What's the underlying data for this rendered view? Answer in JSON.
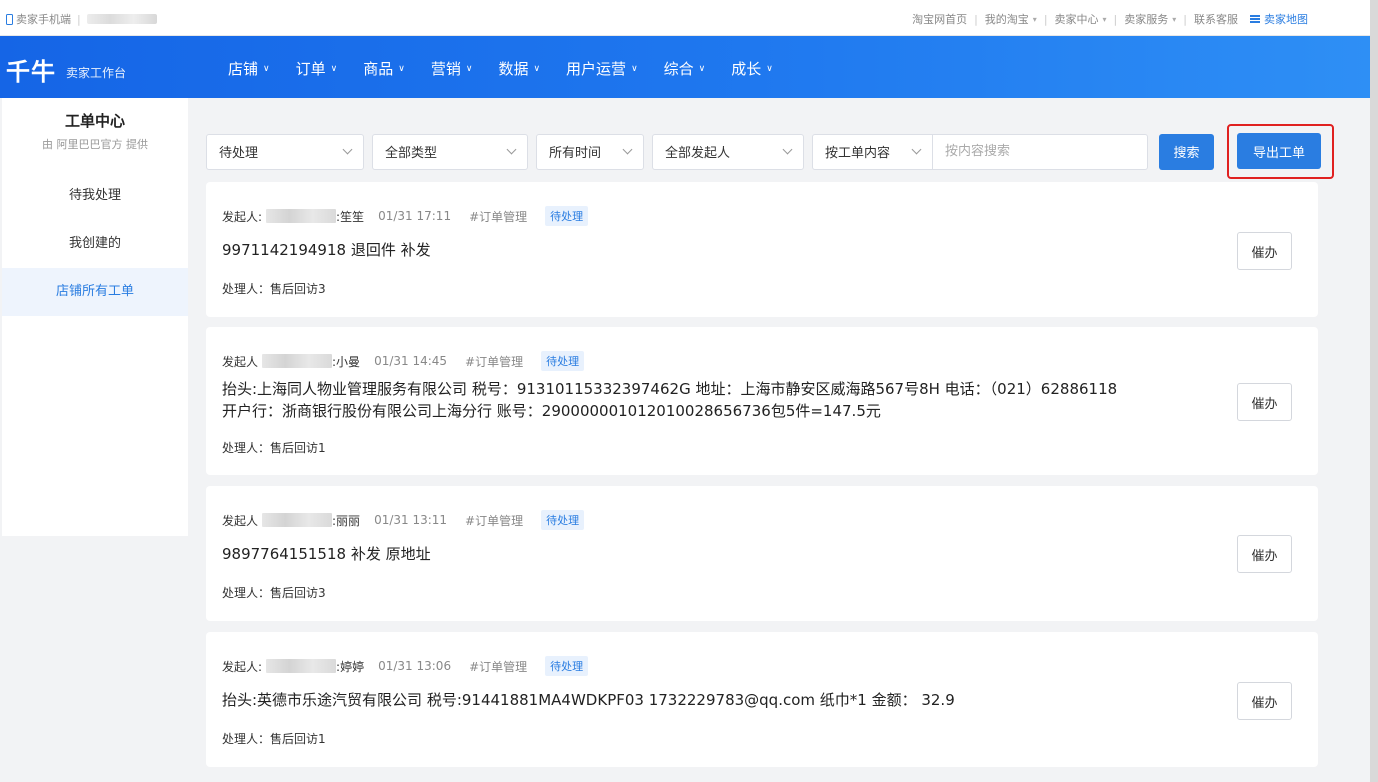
{
  "topbar": {
    "mobile_label": "卖家手机端",
    "links": [
      {
        "label": "淘宝网首页",
        "dropdown": false
      },
      {
        "label": "我的淘宝",
        "dropdown": true
      },
      {
        "label": "卖家中心",
        "dropdown": true
      },
      {
        "label": "卖家服务",
        "dropdown": true
      },
      {
        "label": "联系客服",
        "dropdown": false
      }
    ],
    "map_label": "卖家地图"
  },
  "nav": {
    "logo": "千牛",
    "logo_sub": "卖家工作台",
    "menu": [
      "店铺",
      "订单",
      "商品",
      "营销",
      "数据",
      "用户运营",
      "综合",
      "成长"
    ]
  },
  "sidebar": {
    "title": "工单中心",
    "subtitle": "由 阿里巴巴官方 提供",
    "items": [
      {
        "label": "待我处理",
        "active": false
      },
      {
        "label": "我创建的",
        "active": false
      },
      {
        "label": "店铺所有工单",
        "active": true
      }
    ]
  },
  "filters": {
    "status": "待处理",
    "type": "全部类型",
    "time": "所有时间",
    "initiator": "全部发起人",
    "search_field": "按工单内容",
    "search_placeholder": "按内容搜索",
    "search_button": "搜索",
    "export_button": "导出工单"
  },
  "tickets": [
    {
      "initiator_label": "发起人:",
      "initiator_name": ":笙笙",
      "time": "01/31 17:11",
      "tag": "#订单管理",
      "status": "待处理",
      "content_lines": [
        "9971142194918 退回件 补发"
      ],
      "handler": "处理人：售后回访3",
      "action": "催办"
    },
    {
      "initiator_label": "发起人",
      "initiator_name": ":小曼",
      "time": "01/31 14:45",
      "tag": "#订单管理",
      "status": "待处理",
      "content_lines": [
        "抬头:上海同人物业管理服务有限公司 税号：91310115332397462G 地址：上海市静安区威海路567号8H 电话：（021）62886118",
        "开户行：浙商银行股份有限公司上海分行 账号：290000001012010028656736包5件=147.5元"
      ],
      "handler": "处理人：售后回访1",
      "action": "催办"
    },
    {
      "initiator_label": "发起人",
      "initiator_name": ":丽丽",
      "time": "01/31 13:11",
      "tag": "#订单管理",
      "status": "待处理",
      "content_lines": [
        "9897764151518 补发 原地址"
      ],
      "handler": "处理人：售后回访3",
      "action": "催办"
    },
    {
      "initiator_label": "发起人:",
      "initiator_name": ":婷婷",
      "time": "01/31 13:06",
      "tag": "#订单管理",
      "status": "待处理",
      "content_lines": [
        "抬头:英德市乐途汽贸有限公司 税号:91441881MA4WDKPF03 1732229783@qq.com 纸巾*1 金额： 32.9"
      ],
      "handler": "处理人：售后回访1",
      "action": "催办"
    }
  ],
  "colors": {
    "primary": "#2a7de1",
    "nav_gradient_start": "#1565e6",
    "highlight_border": "#e02020",
    "status_badge_bg": "#e8f1fd"
  }
}
